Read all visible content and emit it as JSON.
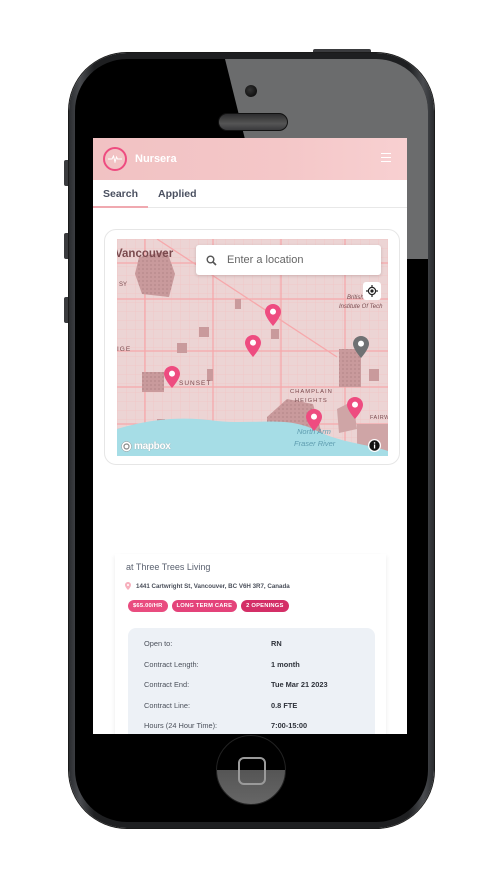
{
  "app": {
    "brand": "Nursera",
    "logo_icon": "heartbeat-icon",
    "menu_icon": "hamburger-menu-icon",
    "accent_color": "#ee4c80",
    "header_color": "#f3c4c5"
  },
  "tabs": [
    {
      "label": "Search",
      "active": true
    },
    {
      "label": "Applied",
      "active": false
    }
  ],
  "map": {
    "search_placeholder": "Enter a location",
    "search_value": "",
    "labels": {
      "city": "Vancouver",
      "sunset": "SUNSET",
      "ridge": "IGE",
      "champlain": "CHAMPLAIN",
      "heights": "HEIGHTS",
      "bcit1": "British",
      "bcit2": "Institute Of Tech",
      "north_arm": "North Arm",
      "fraser": "Fraser River",
      "fairview": "FAIRW",
      "sy": "SY"
    },
    "attribution": "mapbox",
    "pins": [
      {
        "color": "#ee4c80",
        "state": "job"
      },
      {
        "color": "#ee4c80",
        "state": "job"
      },
      {
        "color": "#ee4c80",
        "state": "job"
      },
      {
        "color": "#6f7173",
        "state": "current-location"
      },
      {
        "color": "#ee4c80",
        "state": "job"
      },
      {
        "color": "#ee4c80",
        "state": "job"
      }
    ]
  },
  "job": {
    "title": "at Three Trees Living",
    "address": "1441 Cartwright St, Vancouver, BC V6H 3R7, Canada",
    "badges": [
      {
        "label": "$65.00/HR",
        "color": "#e94c7f"
      },
      {
        "label": "LONG TERM CARE",
        "color": "#e4437a"
      },
      {
        "label": "2 OPENINGS",
        "color": "#d42f67"
      }
    ],
    "details": [
      {
        "label": "Open to:",
        "value": "RN"
      },
      {
        "label": "Contract Length:",
        "value": "1 month"
      },
      {
        "label": "Contract End:",
        "value": "Tue Mar 21 2023"
      },
      {
        "label": "Contract Line:",
        "value": "0.8 FTE"
      },
      {
        "label": "Hours (24 Hour Time):",
        "value": "7:00-15:00"
      }
    ]
  }
}
